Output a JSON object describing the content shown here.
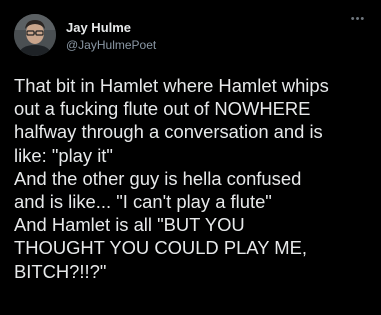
{
  "tweet": {
    "author": {
      "name": "Jay Hulme",
      "handle": "@JayHulmePoet"
    },
    "more_icon": "ellipsis-icon",
    "lines": [
      "That bit in Hamlet where Hamlet whips",
      "out a fucking flute out of NOWHERE",
      "halfway through a conversation and is",
      "like: \"play it\"",
      "And the other guy is hella confused",
      "and is like... \"I can't play a flute\"",
      "And Hamlet is all \"BUT YOU",
      "THOUGHT YOU COULD PLAY ME,",
      "BITCH?!!?\""
    ]
  },
  "colors": {
    "background": "#000000",
    "text_primary": "#e7e9ea",
    "text_secondary": "#8b98a5"
  }
}
